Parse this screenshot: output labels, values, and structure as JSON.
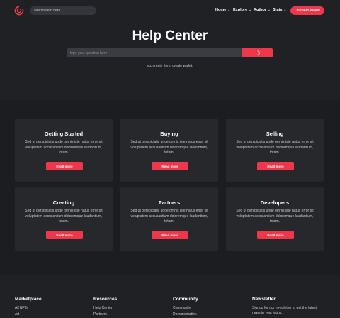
{
  "header": {
    "search_placeholder": "search item here...",
    "nav": [
      {
        "label": "Home",
        "chevron": "⌄"
      },
      {
        "label": "Explore",
        "chevron": "⌄"
      },
      {
        "label": "Author",
        "chevron": "⌄"
      },
      {
        "label": "Stats",
        "chevron": "⌄"
      }
    ],
    "connect_label": "Connect Wallet",
    "accent": "#f0364b"
  },
  "hero": {
    "title": "Help Center",
    "input_placeholder": "type your question here",
    "button_icon": "arrow-right-icon",
    "hint": "eg. create item, create wallet."
  },
  "cards": [
    {
      "title": "Getting Started",
      "text": "Sed ut perspiciatis unde omnis iste natus error sit voluptatem accusantium doloremque laudantium, totam.",
      "button": "Read more"
    },
    {
      "title": "Buying",
      "text": "Sed ut perspiciatis unde omnis iste natus error sit voluptatem accusantium doloremque laudantium, totam.",
      "button": "Read more"
    },
    {
      "title": "Selling",
      "text": "Sed ut perspiciatis unde omnis iste natus error sit voluptatem accusantium doloremque laudantium, totam.",
      "button": "Read more"
    },
    {
      "title": "Creating",
      "text": "Sed ut perspiciatis unde omnis iste natus error sit voluptatem accusantium doloremque laudantium, totam.",
      "button": "Read more"
    },
    {
      "title": "Partners",
      "text": "Sed ut perspiciatis unde omnis iste natus error sit voluptatem accusantium doloremque laudantium, totam.",
      "button": "Read more"
    },
    {
      "title": "Developers",
      "text": "Sed ut perspiciatis unde omnis iste natus error sit voluptatem accusantium doloremque laudantium, totam.",
      "button": "Read more"
    }
  ],
  "footer": {
    "marketplace": {
      "heading": "Marketplace",
      "links": [
        "All NFTs",
        "Art"
      ]
    },
    "resources": {
      "heading": "Resources",
      "links": [
        "Help Center",
        "Partners"
      ]
    },
    "community": {
      "heading": "Community",
      "links": [
        "Community",
        "Documentation"
      ]
    },
    "newsletter": {
      "heading": "Newsletter",
      "text": "Signup for our newsletter to get the latest news in your inbox."
    }
  }
}
